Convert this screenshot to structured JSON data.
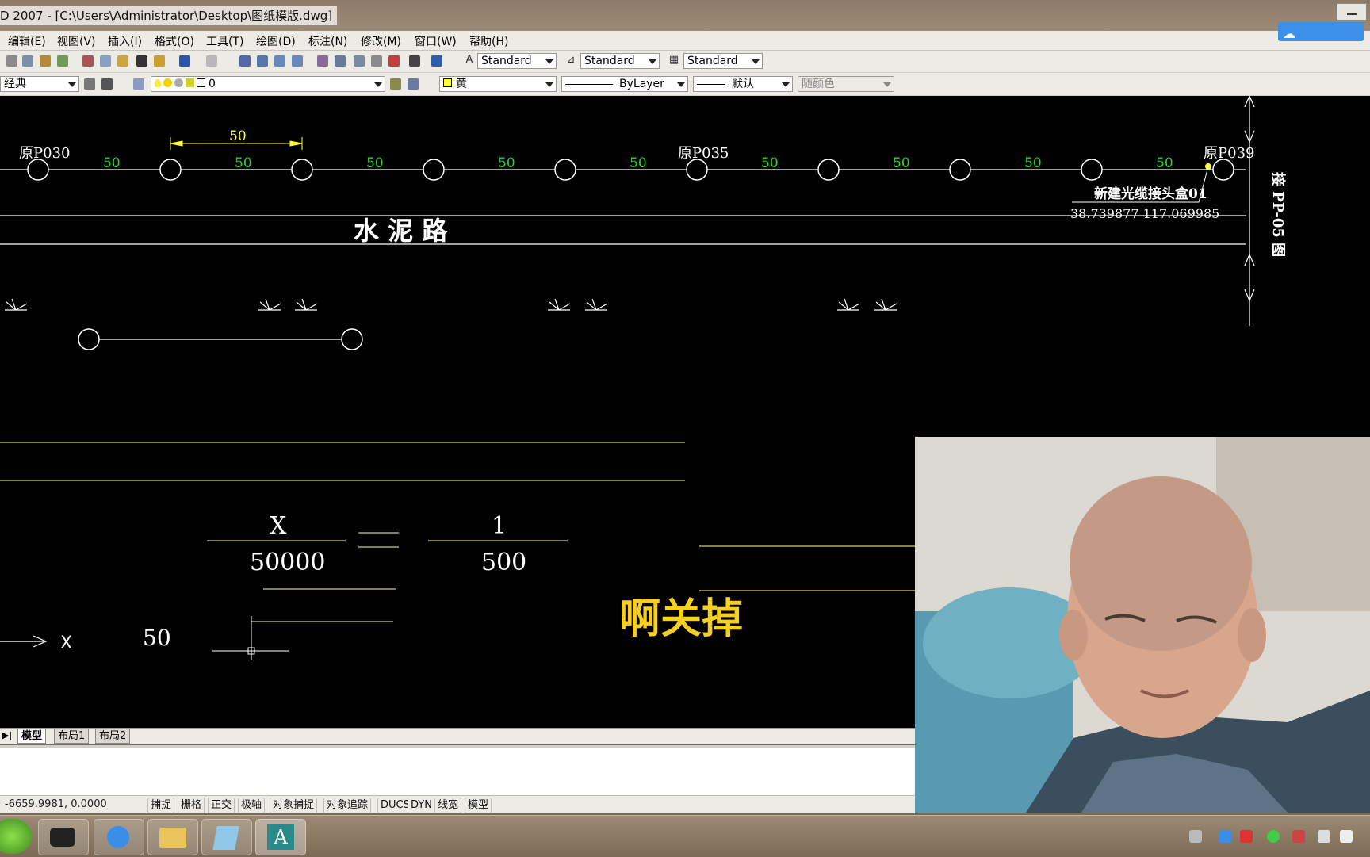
{
  "window": {
    "title": "D 2007 - [C:\\Users\\Administrator\\Desktop\\图纸模版.dwg]"
  },
  "menu": [
    "编辑(E)",
    "视图(V)",
    "插入(I)",
    "格式(O)",
    "工具(T)",
    "绘图(D)",
    "标注(N)",
    "修改(M)",
    "窗口(W)",
    "帮助(H)"
  ],
  "styles_toolbar": {
    "text_style": "Standard",
    "dim_style": "Standard",
    "table_style": "Standard"
  },
  "layers_toolbar": {
    "workspace": "经典",
    "layer": "0",
    "color": "黄",
    "linetype": "ByLayer",
    "lineweight": "默认",
    "plotstyle": "随颜色"
  },
  "drawing": {
    "poles": {
      "left": "原P030",
      "mid": "原P035",
      "right": "原P039"
    },
    "span_dims": [
      "50",
      "50",
      "50",
      "50",
      "50",
      "50",
      "50",
      "50",
      "50"
    ],
    "top_dim": "50",
    "road_label": "水 泥 路",
    "joint_box": "新建光缆接头盒01",
    "joint_coords": "38.739877 117.069985",
    "side_note": "接 PP-05 图",
    "fraction_left_num": "X",
    "fraction_left_den": "50000",
    "fraction_right_num": "1",
    "fraction_right_den": "500",
    "bottom_dim": "50",
    "axis_label": "X",
    "subtitle": "啊关掉"
  },
  "layout_tabs": [
    "模型",
    "布局1",
    "布局2"
  ],
  "status": {
    "coords": "-6659.9981, 0.0000",
    "toggles": [
      "捕捉",
      "栅格",
      "正交",
      "极轴",
      "对象捕捉",
      "对象追踪",
      "DUCS",
      "DYN",
      "线宽",
      "模型"
    ]
  },
  "colors": {
    "dim_green": "#22dd22",
    "dim_yellow": "#ffff33",
    "subtitle": "#f5d020",
    "canvas": "#000000"
  }
}
